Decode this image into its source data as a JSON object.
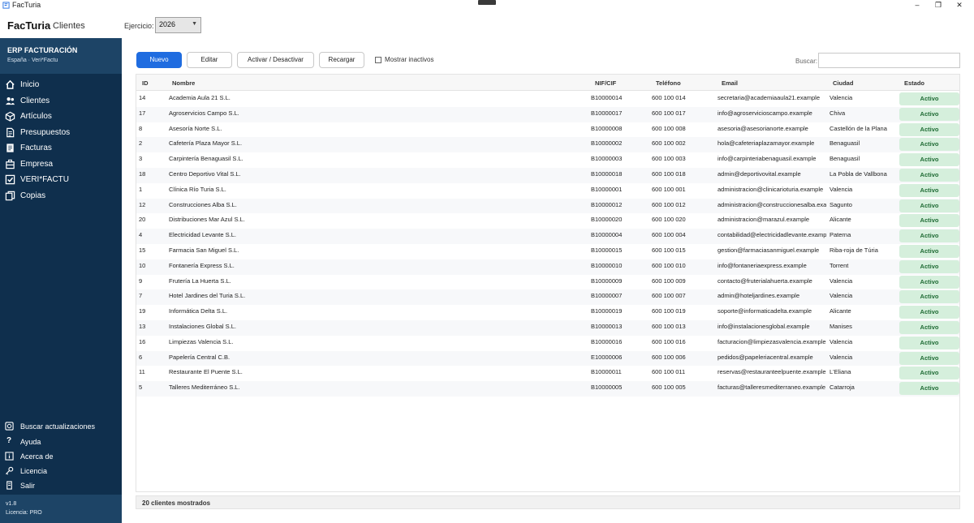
{
  "window": {
    "title": "FacTuria",
    "controls": [
      "minimize-icon",
      "maximize-icon",
      "close-icon"
    ]
  },
  "header": {
    "app_name": "FacTuria",
    "section": "Clientes",
    "ejercicio_label": "Ejercicio:",
    "ejercicio_value": "2026"
  },
  "sidebar": {
    "brand_title": "ERP FACTURACIÓN",
    "brand_sub": "España · Veri*Factu",
    "items": [
      {
        "label": "Inicio",
        "icon": "home-icon"
      },
      {
        "label": "Clientes",
        "icon": "users-icon"
      },
      {
        "label": "Artículos",
        "icon": "box-icon"
      },
      {
        "label": "Presupuestos",
        "icon": "document-icon"
      },
      {
        "label": "Facturas",
        "icon": "invoice-icon"
      },
      {
        "label": "Empresa",
        "icon": "building-icon"
      },
      {
        "label": "VERI*FACTU",
        "icon": "check-square-icon"
      },
      {
        "label": "Copias",
        "icon": "copy-icon"
      }
    ],
    "utilities": [
      {
        "label": "Buscar actualizaciones",
        "icon": "update-icon"
      },
      {
        "label": "Ayuda",
        "icon": "help-icon"
      },
      {
        "label": "Acerca de",
        "icon": "info-icon"
      },
      {
        "label": "Licencia",
        "icon": "key-icon"
      },
      {
        "label": "Salir",
        "icon": "exit-icon"
      }
    ],
    "version": "v1.8",
    "license": "Licencia: PRO"
  },
  "toolbar": {
    "nuevo": "Nuevo",
    "editar": "Editar",
    "activar": "Activar / Desactivar",
    "recargar": "Recargar",
    "mostrar_inactivos": "Mostrar inactivos",
    "mostrar_inactivos_checked": false,
    "buscar_label": "Buscar:",
    "buscar_value": ""
  },
  "table": {
    "columns": {
      "id": "ID",
      "nombre": "Nombre",
      "nif": "NIF/CIF",
      "telefono": "Teléfono",
      "email": "Email",
      "ciudad": "Ciudad",
      "estado": "Estado"
    },
    "rows": [
      {
        "id": "14",
        "nombre": "Academia Aula 21 S.L.",
        "nif": "B10000014",
        "telefono": "600 100 014",
        "email": "secretaria@academiaaula21.example",
        "ciudad": "Valencia",
        "estado": "Activo"
      },
      {
        "id": "17",
        "nombre": "Agroservicios Campo S.L.",
        "nif": "B10000017",
        "telefono": "600 100 017",
        "email": "info@agroservicioscampo.example",
        "ciudad": "Chiva",
        "estado": "Activo"
      },
      {
        "id": "8",
        "nombre": "Asesoría Norte S.L.",
        "nif": "B10000008",
        "telefono": "600 100 008",
        "email": "asesoria@asesorianorte.example",
        "ciudad": "Castellón de la Plana",
        "estado": "Activo"
      },
      {
        "id": "2",
        "nombre": "Cafetería Plaza Mayor S.L.",
        "nif": "B10000002",
        "telefono": "600 100 002",
        "email": "hola@cafeteriaplazamayor.example",
        "ciudad": "Benaguasil",
        "estado": "Activo"
      },
      {
        "id": "3",
        "nombre": "Carpintería Benaguasil S.L.",
        "nif": "B10000003",
        "telefono": "600 100 003",
        "email": "info@carpinteriabenaguasil.example",
        "ciudad": "Benaguasil",
        "estado": "Activo"
      },
      {
        "id": "18",
        "nombre": "Centro Deportivo Vital S.L.",
        "nif": "B10000018",
        "telefono": "600 100 018",
        "email": "admin@deportivovital.example",
        "ciudad": "La Pobla de Vallbona",
        "estado": "Activo"
      },
      {
        "id": "1",
        "nombre": "Clínica Río Turia S.L.",
        "nif": "B10000001",
        "telefono": "600 100 001",
        "email": "administracion@clinicarioturia.example",
        "ciudad": "Valencia",
        "estado": "Activo"
      },
      {
        "id": "12",
        "nombre": "Construcciones Alba S.L.",
        "nif": "B10000012",
        "telefono": "600 100 012",
        "email": "administracion@construccionesalba.exar",
        "ciudad": "Sagunto",
        "estado": "Activo"
      },
      {
        "id": "20",
        "nombre": "Distribuciones Mar Azul S.L.",
        "nif": "B10000020",
        "telefono": "600 100 020",
        "email": "administracion@marazul.example",
        "ciudad": "Alicante",
        "estado": "Activo"
      },
      {
        "id": "4",
        "nombre": "Electricidad Levante S.L.",
        "nif": "B10000004",
        "telefono": "600 100 004",
        "email": "contabilidad@electricidadlevante.examp",
        "ciudad": "Paterna",
        "estado": "Activo"
      },
      {
        "id": "15",
        "nombre": "Farmacia San Miguel S.L.",
        "nif": "B10000015",
        "telefono": "600 100 015",
        "email": "gestion@farmaciasanmiguel.example",
        "ciudad": "Riba-roja de Túria",
        "estado": "Activo"
      },
      {
        "id": "10",
        "nombre": "Fontanería Express S.L.",
        "nif": "B10000010",
        "telefono": "600 100 010",
        "email": "info@fontaneriaexpress.example",
        "ciudad": "Torrent",
        "estado": "Activo"
      },
      {
        "id": "9",
        "nombre": "Frutería La Huerta S.L.",
        "nif": "B10000009",
        "telefono": "600 100 009",
        "email": "contacto@fruterialahuerta.example",
        "ciudad": "Valencia",
        "estado": "Activo"
      },
      {
        "id": "7",
        "nombre": "Hotel Jardines del Turia S.L.",
        "nif": "B10000007",
        "telefono": "600 100 007",
        "email": "admin@hoteljardines.example",
        "ciudad": "Valencia",
        "estado": "Activo"
      },
      {
        "id": "19",
        "nombre": "Informática Delta S.L.",
        "nif": "B10000019",
        "telefono": "600 100 019",
        "email": "soporte@informaticadelta.example",
        "ciudad": "Alicante",
        "estado": "Activo"
      },
      {
        "id": "13",
        "nombre": "Instalaciones Global S.L.",
        "nif": "B10000013",
        "telefono": "600 100 013",
        "email": "info@instalacionesglobal.example",
        "ciudad": "Manises",
        "estado": "Activo"
      },
      {
        "id": "16",
        "nombre": "Limpiezas Valencia S.L.",
        "nif": "B10000016",
        "telefono": "600 100 016",
        "email": "facturacion@limpiezasvalencia.example",
        "ciudad": "Valencia",
        "estado": "Activo"
      },
      {
        "id": "6",
        "nombre": "Papelería Central C.B.",
        "nif": "E10000006",
        "telefono": "600 100 006",
        "email": "pedidos@papeleriacentral.example",
        "ciudad": "Valencia",
        "estado": "Activo"
      },
      {
        "id": "11",
        "nombre": "Restaurante El Puente S.L.",
        "nif": "B10000011",
        "telefono": "600 100 011",
        "email": "reservas@restauranteelpuente.example",
        "ciudad": "L'Eliana",
        "estado": "Activo"
      },
      {
        "id": "5",
        "nombre": "Talleres Mediterráneo S.L.",
        "nif": "B10000005",
        "telefono": "600 100 005",
        "email": "facturas@talleresmediterraneo.example",
        "ciudad": "Catarroja",
        "estado": "Activo"
      }
    ]
  },
  "status": {
    "text": "20 clientes mostrados"
  },
  "colors": {
    "sidebar_bg": "#0f2f4d",
    "sidebar_block": "#1d4466",
    "primary": "#1f6ce0",
    "badge_bg": "#d5efdc",
    "badge_text": "#1f6b34"
  }
}
